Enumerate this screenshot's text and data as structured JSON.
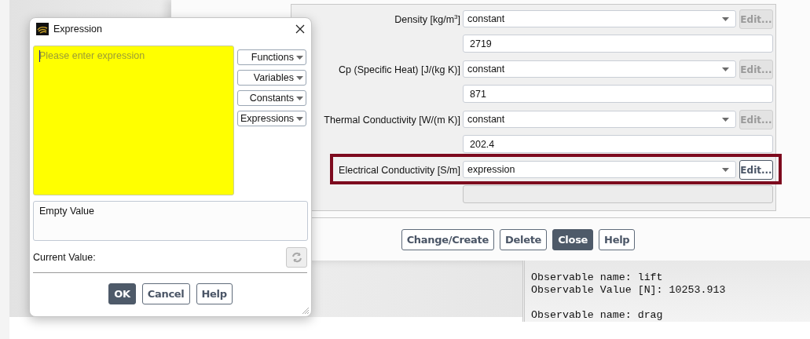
{
  "materials_panel": {
    "properties": [
      {
        "label": "Density [kg/m$^{3}$]",
        "method": "constant",
        "edit_label": "Edit...",
        "edit_disabled": true,
        "value": "2719",
        "value_disabled": false,
        "highlighted": false
      },
      {
        "label": "Cp (Specific Heat) [J/(kg K)]",
        "method": "constant",
        "edit_label": "Edit...",
        "edit_disabled": true,
        "value": "871",
        "value_disabled": false,
        "highlighted": false
      },
      {
        "label": "Thermal Conductivity [W/(m K)]",
        "method": "constant",
        "edit_label": "Edit...",
        "edit_disabled": true,
        "value": "202.4",
        "value_disabled": false,
        "highlighted": false
      },
      {
        "label": "Electrical Conductivity [S/m]",
        "method": "expression",
        "edit_label": "Edit...",
        "edit_disabled": false,
        "value_disabled": true,
        "highlighted": true
      }
    ],
    "buttons": [
      {
        "label": "Change/Create",
        "primary": false
      },
      {
        "label": "Delete",
        "primary": false
      },
      {
        "label": "Close",
        "primary": true
      },
      {
        "label": "Help",
        "primary": false
      }
    ]
  },
  "console": {
    "blocks": [
      [
        "Observable name: lift",
        "Observable Value [N]: 10253.913"
      ],
      [
        "Observable name: drag"
      ]
    ]
  },
  "expression_dialog": {
    "title": "Expression",
    "editor": {
      "placeholder": "Please enter expression"
    },
    "menus": [
      "Functions",
      "Variables",
      "Constants",
      "Expressions"
    ],
    "preview": {
      "value": "Empty Value"
    },
    "current_value_label": "Current Value:",
    "refresh_button": {
      "disabled": true
    },
    "buttons": [
      {
        "label": "OK",
        "primary": true
      },
      {
        "label": "Cancel",
        "primary": false
      },
      {
        "label": "Help",
        "primary": false
      }
    ]
  }
}
